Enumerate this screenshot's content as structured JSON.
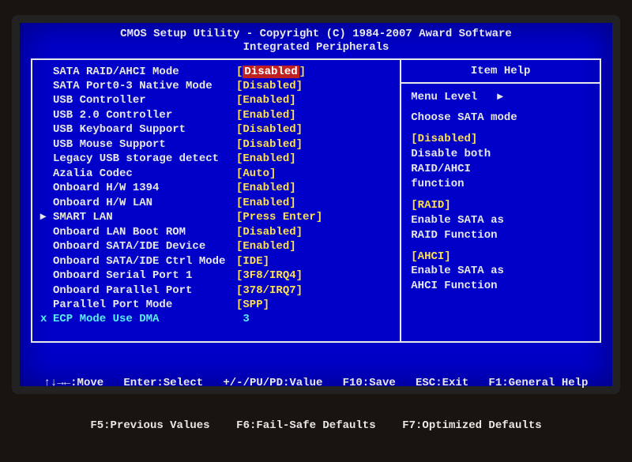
{
  "header": {
    "line1": "CMOS Setup Utility - Copyright (C) 1984-2007 Award Software",
    "line2": "Integrated Peripherals"
  },
  "settings": [
    {
      "marker": "",
      "label": "SATA RAID/AHCI Mode",
      "value": "Disabled",
      "selected": true,
      "yellow": true,
      "cls": ""
    },
    {
      "marker": "",
      "label": "SATA Port0-3 Native Mode",
      "value": "Disabled",
      "selected": false,
      "yellow": true,
      "cls": ""
    },
    {
      "marker": "",
      "label": "USB Controller",
      "value": "Enabled",
      "selected": false,
      "yellow": true,
      "cls": ""
    },
    {
      "marker": "",
      "label": "USB 2.0 Controller",
      "value": "Enabled",
      "selected": false,
      "yellow": true,
      "cls": ""
    },
    {
      "marker": "",
      "label": "USB Keyboard Support",
      "value": "Disabled",
      "selected": false,
      "yellow": true,
      "cls": ""
    },
    {
      "marker": "",
      "label": "USB Mouse Support",
      "value": "Disabled",
      "selected": false,
      "yellow": true,
      "cls": ""
    },
    {
      "marker": "",
      "label": "Legacy USB storage detect",
      "value": "Enabled",
      "selected": false,
      "yellow": true,
      "cls": ""
    },
    {
      "marker": "",
      "label": "Azalia Codec",
      "value": "Auto",
      "selected": false,
      "yellow": true,
      "cls": ""
    },
    {
      "marker": "",
      "label": "Onboard H/W 1394",
      "value": "Enabled",
      "selected": false,
      "yellow": true,
      "cls": ""
    },
    {
      "marker": "",
      "label": "Onboard H/W LAN",
      "value": "Enabled",
      "selected": false,
      "yellow": true,
      "cls": ""
    },
    {
      "marker": "▸",
      "label": "SMART LAN",
      "value": "Press Enter",
      "selected": false,
      "yellow": true,
      "cls": ""
    },
    {
      "marker": "",
      "label": "Onboard LAN Boot ROM",
      "value": "Disabled",
      "selected": false,
      "yellow": true,
      "cls": ""
    },
    {
      "marker": "",
      "label": "Onboard SATA/IDE Device",
      "value": "Enabled",
      "selected": false,
      "yellow": true,
      "cls": ""
    },
    {
      "marker": "",
      "label": "Onboard SATA/IDE Ctrl Mode",
      "value": "IDE",
      "selected": false,
      "yellow": true,
      "cls": ""
    },
    {
      "marker": "",
      "label": "Onboard Serial Port 1",
      "value": "3F8/IRQ4",
      "selected": false,
      "yellow": true,
      "cls": ""
    },
    {
      "marker": "",
      "label": "Onboard Parallel Port",
      "value": "378/IRQ7",
      "selected": false,
      "yellow": true,
      "cls": ""
    },
    {
      "marker": "",
      "label": "Parallel Port Mode",
      "value": "SPP",
      "selected": false,
      "yellow": true,
      "cls": ""
    },
    {
      "marker": "x",
      "label": "ECP Mode Use DMA",
      "value": "3",
      "selected": false,
      "yellow": false,
      "cls": "cyan",
      "nobrackets": true
    }
  ],
  "help": {
    "title": "Item Help",
    "menu_level": "Menu Level",
    "desc": "Choose SATA mode",
    "blocks": [
      {
        "head": "[Disabled]",
        "body1": "Disable both",
        "body2": "RAID/AHCI",
        "body3": "function"
      },
      {
        "head": "[RAID]",
        "body1": "Enable SATA as",
        "body2": "RAID Function",
        "body3": ""
      },
      {
        "head": "[AHCI]",
        "body1": "Enable SATA as",
        "body2": "AHCI Function",
        "body3": ""
      }
    ]
  },
  "footer": {
    "line1": "↑↓→←:Move   Enter:Select   +/-/PU/PD:Value   F10:Save   ESC:Exit   F1:General Help",
    "line2": "F5:Previous Values    F6:Fail-Safe Defaults    F7:Optimized Defaults"
  }
}
